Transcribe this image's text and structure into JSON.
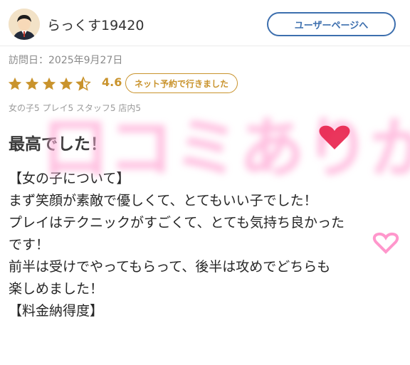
{
  "user": {
    "name": "らっくす19420",
    "profile_button": "ユーザーページへ"
  },
  "visit": {
    "label": "訪問日：2025年9月27日"
  },
  "rating": {
    "stars": 4.5,
    "value": "4.6",
    "badge": "ネット予約で行きました",
    "breakdown": "女の子5 プレイ5 スタッフ5 店内5"
  },
  "review": {
    "title": "最高でした！",
    "lines": [
      "【女の子について】",
      "まず笑顔が素敵で優しくて、とてもいい子でした！",
      "プレイはテクニックがすごくて、とても気持ち良かった",
      "です！",
      "前半は受けでやってもらって、後半は攻めでどちらも",
      "楽しめました！",
      "【料金納得度】"
    ]
  },
  "overlay": {
    "stamp_text": "口コミありがとう"
  },
  "colors": {
    "accent_blue": "#3d6fae",
    "star_gold": "#c9932c",
    "heart_red": "#e8204a",
    "watermark_pink": "#ff8cc6"
  },
  "icons": {
    "avatar": "person-avatar-icon",
    "star": "star-icon",
    "heart": "heart-icon"
  }
}
